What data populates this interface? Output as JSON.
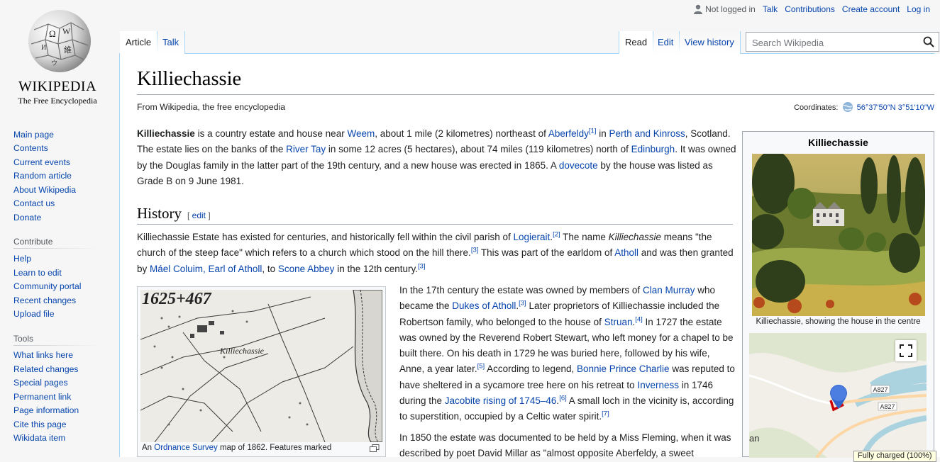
{
  "logo": {
    "wordmark": "WIKIPEDIA",
    "tagline": "The Free Encyclopedia"
  },
  "personal": {
    "not_logged_in": "Not logged in",
    "talk": "Talk",
    "contributions": "Contributions",
    "create_account": "Create account",
    "log_in": "Log in"
  },
  "tabs": {
    "article": "Article",
    "talk": "Talk",
    "read": "Read",
    "edit": "Edit",
    "view_history": "View history"
  },
  "search": {
    "placeholder": "Search Wikipedia"
  },
  "sidebar": {
    "navigation": [
      "Main page",
      "Contents",
      "Current events",
      "Random article",
      "About Wikipedia",
      "Contact us",
      "Donate"
    ],
    "contribute_heading": "Contribute",
    "contribute": [
      "Help",
      "Learn to edit",
      "Community portal",
      "Recent changes",
      "Upload file"
    ],
    "tools_heading": "Tools",
    "tools": [
      "What links here",
      "Related changes",
      "Special pages",
      "Permanent link",
      "Page information",
      "Cite this page",
      "Wikidata item"
    ]
  },
  "article": {
    "title": "Killiechassie",
    "tagline": "From Wikipedia, the free encyclopedia",
    "coordinates_label": "Coordinates:",
    "coordinates_value": "56°37′50″N 3°51′10″W",
    "lead": {
      "bold_title": "Killiechassie",
      "t1": " is a country estate and house near ",
      "l_weem": "Weem",
      "t2": ", about 1 mile (2 kilometres) northeast of ",
      "l_aberfeldy": "Aberfeldy",
      "r1": "[1]",
      "t3": " in ",
      "l_perth": "Perth and Kinross",
      "t4": ", Scotland. The estate lies on the banks of the ",
      "l_tay": "River Tay",
      "t5": " in some 12 acres (5 hectares), about 74 miles (119 kilometres) north of ",
      "l_edinburgh": "Edinburgh",
      "t6": ". It was owned by the Douglas family in the latter part of the 19th century, and a new house was erected in 1865. A ",
      "l_dovecote": "dovecote",
      "t7": " by the house was listed as Grade B on 9 June 1981."
    },
    "history_heading": "History",
    "edit_link": "edit",
    "hist1": {
      "t1": "Killiechassie Estate has existed for centuries, and historically fell within the civil parish of ",
      "l_logierait": "Logierait",
      "r2": "[2]",
      "t2": " The name ",
      "i_name": "Killiechassie",
      "t3": " means \"the church of the steep face\" which refers to a church which stood on the hill there.",
      "r3a": "[3]",
      "t4": " This was part of the earldom of ",
      "l_atholl": "Atholl",
      "t5": " and was then granted by ",
      "l_mael": "Máel Coluim, Earl of Atholl",
      "t6": ", to ",
      "l_scone": "Scone Abbey",
      "t7": " in the 12th century.",
      "r3b": "[3]"
    },
    "hist2": {
      "t1": "In the 17th century the estate was owned by members of ",
      "l_clan": "Clan Murray",
      "t2": " who became the ",
      "l_dukes": "Dukes of Atholl",
      "r3": "[3]",
      "t3": " Later proprietors of Killiechassie included the Robertson family, who belonged to the house of ",
      "l_struan": "Struan",
      "r4": "[4]",
      "t4": " In 1727 the estate was owned by the Reverend Robert Stewart, who left money for a chapel to be built there. On his death in 1729 he was buried here, followed by his wife, Anne, a year later.",
      "r5": "[5]",
      "t5": " According to legend, ",
      "l_bonnie": "Bonnie Prince Charlie",
      "t6": " was reputed to have sheltered in a sycamore tree here on his retreat to ",
      "l_inverness": "Inverness",
      "t7": " in 1746 during the ",
      "l_jacobite": "Jacobite rising of 1745–46",
      "r6": "[6]",
      "t8": " A small loch in the vicinity is, according to superstition, occupied by a Celtic water spirit.",
      "r7": "[7]"
    },
    "hist3": {
      "t1": "In 1850 the estate was documented to be held by a Miss Fleming, when it was described by poet David Millar as \"almost opposite Aberfeldy, a sweet"
    },
    "thumb": {
      "map_year": "1625+467",
      "map_label": "Killiechassie",
      "cap_t1": "An ",
      "cap_link": "Ordnance Survey",
      "cap_t2": " map of 1862. Features marked"
    }
  },
  "infobox": {
    "title": "Killiechassie",
    "photo_caption": "Killiechassie, showing the house in the centre",
    "map_road_1": "A827",
    "map_road_2": "A827",
    "map_place": "an"
  },
  "tooltip": "Fully charged (100%)",
  "colors": {
    "link": "#0645ad",
    "tab_border": "#a7d7f9",
    "sidebar_bg": "#f6f6f6",
    "marker": "#3366cc"
  }
}
